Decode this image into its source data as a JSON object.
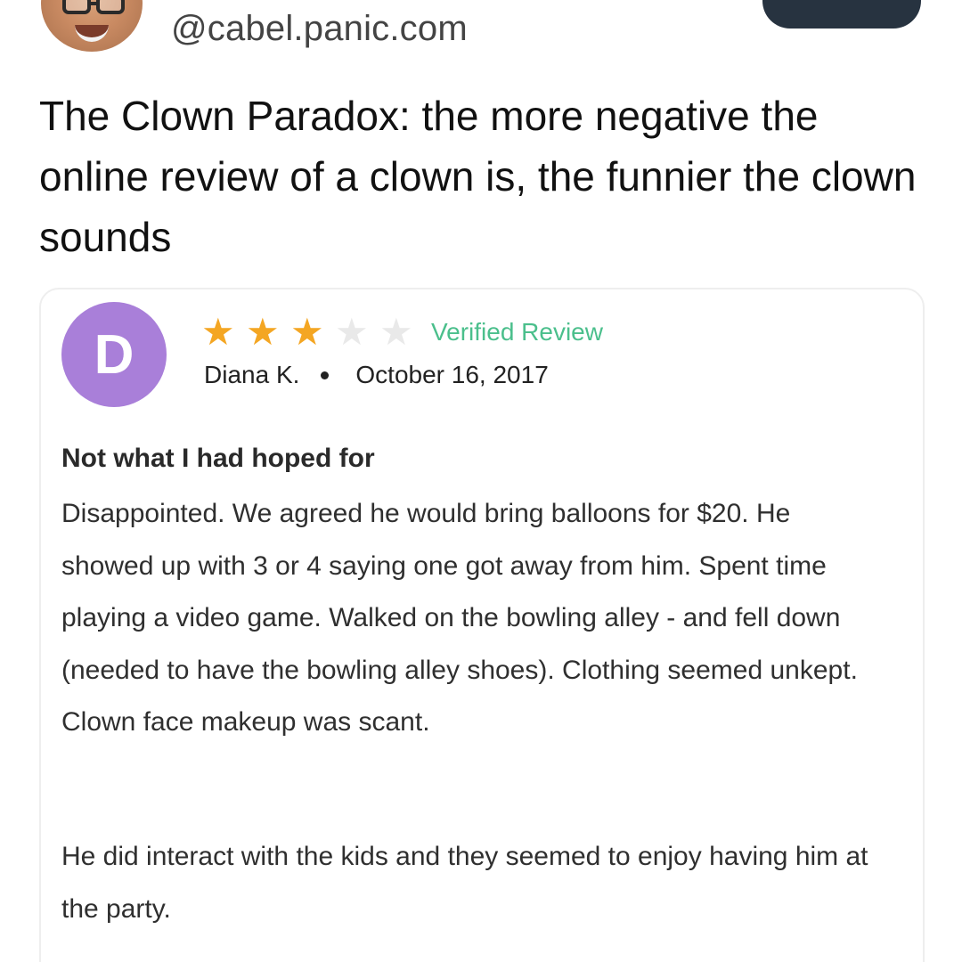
{
  "post": {
    "handle": "@cabel.panic.com",
    "text": "The Clown Paradox: the more negative the online review of a clown is, the funnier the clown sounds"
  },
  "review": {
    "avatar_letter": "D",
    "rating": 3,
    "max_rating": 5,
    "verified_label": "Verified Review",
    "reviewer": "Diana K.",
    "date": "October 16, 2017",
    "title": "Not what I had hoped for",
    "body_paragraph_1": "Disappointed. We agreed he would bring balloons for $20. He showed up with 3 or 4 saying one got away from him. Spent time playing a video game. Walked on the bowling alley - and fell down (needed to have the bowling alley shoes). Clothing seemed unkept. Clown face makeup was scant.",
    "body_paragraph_2": "He did interact with the kids and they seemed to enjoy having him at the party."
  },
  "colors": {
    "star_filled": "#f4a623",
    "star_empty": "#e9e9e9",
    "verified_text": "#4bbf8c",
    "avatar_bg": "#a97fd9",
    "follow_button": "#273340"
  },
  "icons": {
    "star": "star-icon",
    "separator": "dot-icon"
  }
}
